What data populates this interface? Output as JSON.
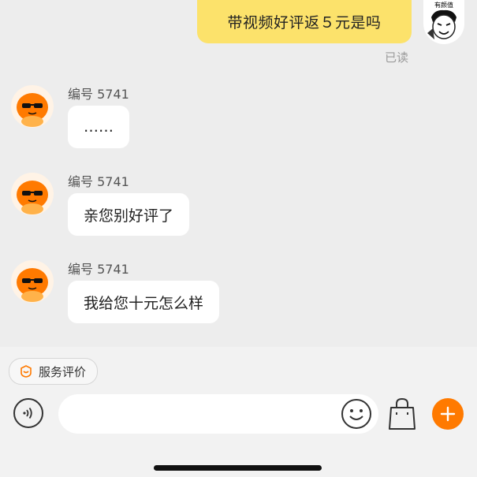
{
  "outgoing": {
    "text": "带视频好评返５元是吗",
    "read_status": "已读",
    "self_avatar_caption": "有颜值"
  },
  "messages": [
    {
      "sender": "编号 5741",
      "text": "……"
    },
    {
      "sender": "编号 5741",
      "text": "亲您别好评了"
    },
    {
      "sender": "编号 5741",
      "text": "我给您十元怎么样"
    }
  ],
  "bottom": {
    "service_label": "服务评价",
    "input_value": "",
    "accent_color": "#ff7a00"
  },
  "colors": {
    "outgoing_bubble": "#fce26b",
    "incoming_bubble": "#ffffff",
    "chat_background": "#ededed"
  },
  "icons": {
    "voice": "voice-icon",
    "emoji": "emoji-icon",
    "bag": "shopping-bag-icon",
    "plus": "plus-icon",
    "service": "service-evaluation-icon"
  }
}
